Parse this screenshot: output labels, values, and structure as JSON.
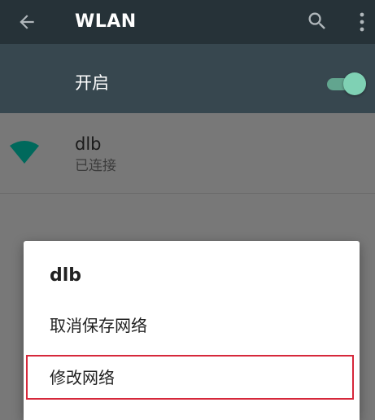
{
  "toolbar": {
    "title": "WLAN",
    "back_icon": "arrow-back-icon",
    "search_icon": "search-icon",
    "more_icon": "more-vert-icon"
  },
  "switch_bar": {
    "label": "开启",
    "enabled": true
  },
  "networks": [
    {
      "name": "dlb",
      "status": "已连接",
      "icon": "wifi-full-signal-icon"
    }
  ],
  "dialog": {
    "title": "dlb",
    "items": [
      {
        "label": "取消保存网络"
      },
      {
        "label": "修改网络",
        "highlighted": true
      }
    ]
  },
  "colors": {
    "toolbar_bg": "#263238",
    "switch_bar_bg": "#37474f",
    "accent": "#7fd1b4",
    "wifi_icon": "#00695c",
    "highlight_border": "#d6283b",
    "scrim": "#787878"
  }
}
